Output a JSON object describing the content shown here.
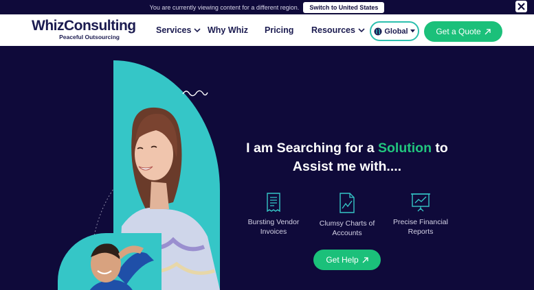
{
  "notice": {
    "text": "You are currently viewing content for a different region.",
    "switch_label": "Switch to United States",
    "close_icon": "close-icon"
  },
  "header": {
    "logo": {
      "name": "WhizConsulting",
      "tagline": "Peaceful Outsourcing"
    },
    "nav": [
      {
        "label": "Services",
        "has_dropdown": true
      },
      {
        "label": "Why Whiz",
        "has_dropdown": false
      },
      {
        "label": "Pricing",
        "has_dropdown": false
      },
      {
        "label": "Resources",
        "has_dropdown": true
      }
    ],
    "region_label": "Global",
    "quote_label": "Get a Quote"
  },
  "hero": {
    "headline_pre": "I am Searching for a",
    "headline_accent": "Solution",
    "headline_post": "to",
    "headline_line2": "Assist me with....",
    "options": [
      {
        "label_line1": "Bursting Vendor",
        "label_line2": "Invoices",
        "icon": "invoice-icon"
      },
      {
        "label_line1": "Clumsy Charts of",
        "label_line2": "Accounts",
        "icon": "chart-document-icon"
      },
      {
        "label_line1": "Precise Financial",
        "label_line2": "Reports",
        "icon": "presentation-chart-icon"
      }
    ],
    "cta_label": "Get Help"
  },
  "colors": {
    "navy": "#0f0a3a",
    "teal": "#35c6c7",
    "green": "#1bc07a",
    "accent_text": "#21c57e"
  }
}
